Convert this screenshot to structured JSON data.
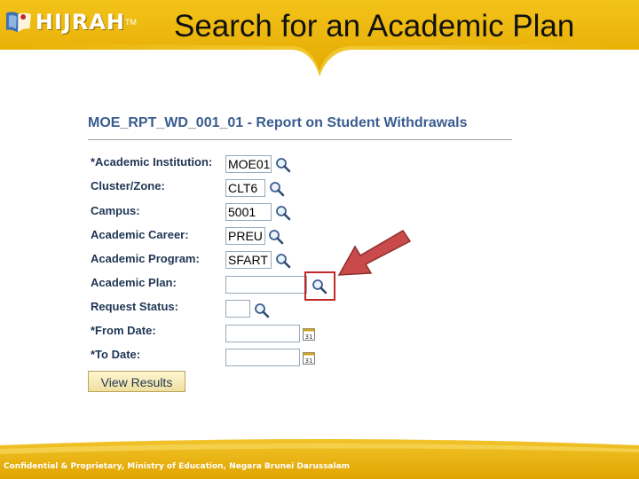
{
  "brand": {
    "logo_text": "HIJRAH",
    "trademark": "TM"
  },
  "slide": {
    "title": "Search for an Academic Plan"
  },
  "report": {
    "title": "MOE_RPT_WD_001_01 - Report on Student Withdrawals"
  },
  "form": {
    "fields": [
      {
        "label": "*Academic Institution:",
        "value": "MOE01"
      },
      {
        "label": "Cluster/Zone:",
        "value": "CLT6"
      },
      {
        "label": "Campus:",
        "value": "5001"
      },
      {
        "label": "Academic Career:",
        "value": "PREU"
      },
      {
        "label": "Academic Program:",
        "value": "SFART"
      },
      {
        "label": "Academic Plan:",
        "value": ""
      },
      {
        "label": "Request Status:",
        "value": ""
      },
      {
        "label": "*From Date:",
        "value": ""
      },
      {
        "label": "*To Date:",
        "value": ""
      }
    ],
    "calendar_icon_text": "31",
    "view_results_label": "View Results"
  },
  "footer": {
    "text": "Confidential & Proprietary, Ministry of Education, Negara Brunei Darussalam"
  },
  "colors": {
    "band": "#e8b400",
    "band_light": "#f6d65a",
    "label": "#1f3654",
    "title_blue": "#3a5d8f",
    "highlight": "#c0282a",
    "arrow": "#c94a4a"
  },
  "icons": [
    "hijrah-logo-icon",
    "magnifier-lookup-icon",
    "calendar-icon",
    "red-pointer-arrow-icon"
  ]
}
